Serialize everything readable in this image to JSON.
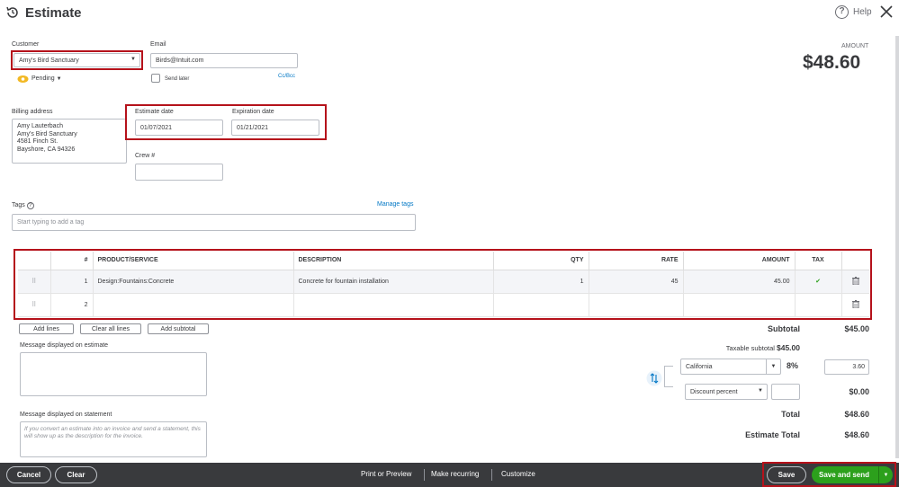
{
  "header": {
    "title": "Estimate",
    "help_label": "Help"
  },
  "customer": {
    "label": "Customer",
    "value": "Amy's Bird Sanctuary",
    "status": "Pending"
  },
  "email": {
    "label": "Email",
    "value": "Birds@Intuit.com",
    "send_later": "Send later",
    "cc_bcc": "Cc/Bcc"
  },
  "amount": {
    "label": "AMOUNT",
    "value": "$48.60"
  },
  "billing": {
    "label": "Billing address",
    "lines": [
      "Amy Lauterbach",
      "Amy's Bird Sanctuary",
      "4581 Finch St.",
      "Bayshore, CA  94326"
    ]
  },
  "dates": {
    "estimate_label": "Estimate date",
    "estimate_value": "01/07/2021",
    "expiration_label": "Expiration date",
    "expiration_value": "01/21/2021"
  },
  "crew": {
    "label": "Crew #",
    "value": ""
  },
  "tags": {
    "label": "Tags",
    "manage": "Manage tags",
    "placeholder": "Start typing to add a tag"
  },
  "table": {
    "headers": {
      "num": "#",
      "product": "PRODUCT/SERVICE",
      "description": "DESCRIPTION",
      "qty": "QTY",
      "rate": "RATE",
      "amount": "AMOUNT",
      "tax": "TAX"
    },
    "rows": [
      {
        "num": "1",
        "product": "Design:Fountains:Concrete",
        "description": "Concrete for fountain installation",
        "qty": "1",
        "rate": "45",
        "amount": "45.00",
        "tax": "✔"
      },
      {
        "num": "2",
        "product": "",
        "description": "",
        "qty": "",
        "rate": "",
        "amount": "",
        "tax": ""
      }
    ]
  },
  "line_buttons": {
    "add_lines": "Add lines",
    "clear_all": "Clear all lines",
    "add_subtotal": "Add subtotal"
  },
  "messages": {
    "estimate_label": "Message displayed on estimate",
    "statement_label": "Message displayed on statement",
    "statement_placeholder": "If you convert an estimate into an invoice and send a statement, this will show up as the description for the invoice."
  },
  "totals": {
    "subtotal_label": "Subtotal",
    "subtotal_value": "$45.00",
    "taxable_label": "Taxable subtotal",
    "taxable_value": "$45.00",
    "tax_region": "California",
    "tax_rate": "8%",
    "tax_value": "3.60",
    "discount_type": "Discount percent",
    "discount_input": "",
    "discount_value": "$0.00",
    "total_label": "Total",
    "total_value": "$48.60",
    "estimate_total_label": "Estimate Total",
    "estimate_total_value": "$48.60"
  },
  "footer": {
    "cancel": "Cancel",
    "clear": "Clear",
    "print_preview": "Print or Preview",
    "make_recurring": "Make recurring",
    "customize": "Customize",
    "save": "Save",
    "save_and_send": "Save and send"
  },
  "colors": {
    "accent_red": "#b5121b",
    "green": "#2ca01c",
    "link_blue": "#0077c5",
    "footer_bg": "#393a3d"
  }
}
